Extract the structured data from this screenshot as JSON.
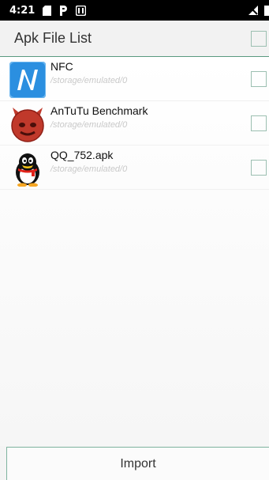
{
  "status_bar": {
    "time": "4:21",
    "left_icons": [
      "sd-card-icon",
      "parking-icon",
      "media-icon"
    ],
    "right_icons": [
      "no-signal-icon"
    ]
  },
  "header": {
    "title": "Apk File List"
  },
  "apk_list": [
    {
      "name": "NFC",
      "path": "/storage/emulated/0",
      "icon": "nfc-app-icon",
      "checked": false
    },
    {
      "name": "AnTuTu Benchmark",
      "path": "/storage/emulated/0",
      "icon": "antutu-app-icon",
      "checked": false
    },
    {
      "name": "QQ_752.apk",
      "path": "/storage/emulated/0",
      "icon": "qq-app-icon",
      "checked": false
    }
  ],
  "footer": {
    "import_label": "Import"
  },
  "colors": {
    "accent": "#7fb49f",
    "header_bg": "#f2f2f2",
    "nfc_blue": "#2b8fe0",
    "antutu_red": "#c0392b"
  }
}
